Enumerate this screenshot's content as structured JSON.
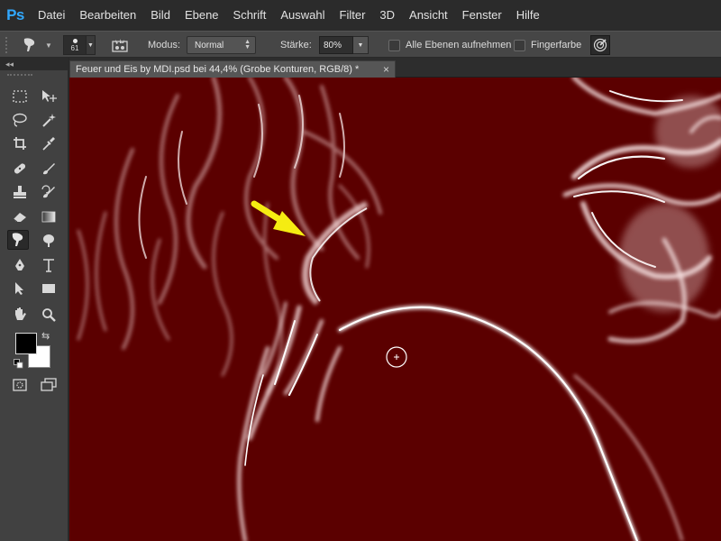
{
  "app": {
    "logo": "Ps"
  },
  "menu": [
    "Datei",
    "Bearbeiten",
    "Bild",
    "Ebene",
    "Schrift",
    "Auswahl",
    "Filter",
    "3D",
    "Ansicht",
    "Fenster",
    "Hilfe"
  ],
  "options": {
    "brush_size": "61",
    "mode_label": "Modus:",
    "mode_value": "Normal",
    "strength_label": "Stärke:",
    "strength_value": "80%",
    "sample_all_label": "Alle Ebenen aufnehmen",
    "finger_label": "Fingerfarbe"
  },
  "toolbox": {
    "collapse_label": "◂◂"
  },
  "document": {
    "tab_title": "Feuer und Eis by MDI.psd bei 44,4% (Grobe Konturen, RGB/8) *",
    "close_glyph": "×"
  },
  "colors": {
    "canvas_bg": "#5a0000",
    "arrow": "#f5ec12",
    "foreground": "#000000",
    "background": "#ffffff",
    "accent": "#31a8ff"
  },
  "icons": [
    "smudge-tool-icon",
    "brush-panel-icon",
    "tablet-pressure-icon",
    "marquee-icon",
    "move-icon",
    "lasso-icon",
    "magic-wand-icon",
    "crop-icon",
    "eyedropper-icon",
    "healing-brush-icon",
    "brush-icon",
    "clone-stamp-icon",
    "history-brush-icon",
    "eraser-icon",
    "gradient-icon",
    "smudge-icon",
    "dodge-icon",
    "pen-icon",
    "type-icon",
    "path-selection-icon",
    "rectangle-icon",
    "hand-icon",
    "zoom-icon",
    "quick-mask-icon",
    "screen-mode-icon"
  ]
}
